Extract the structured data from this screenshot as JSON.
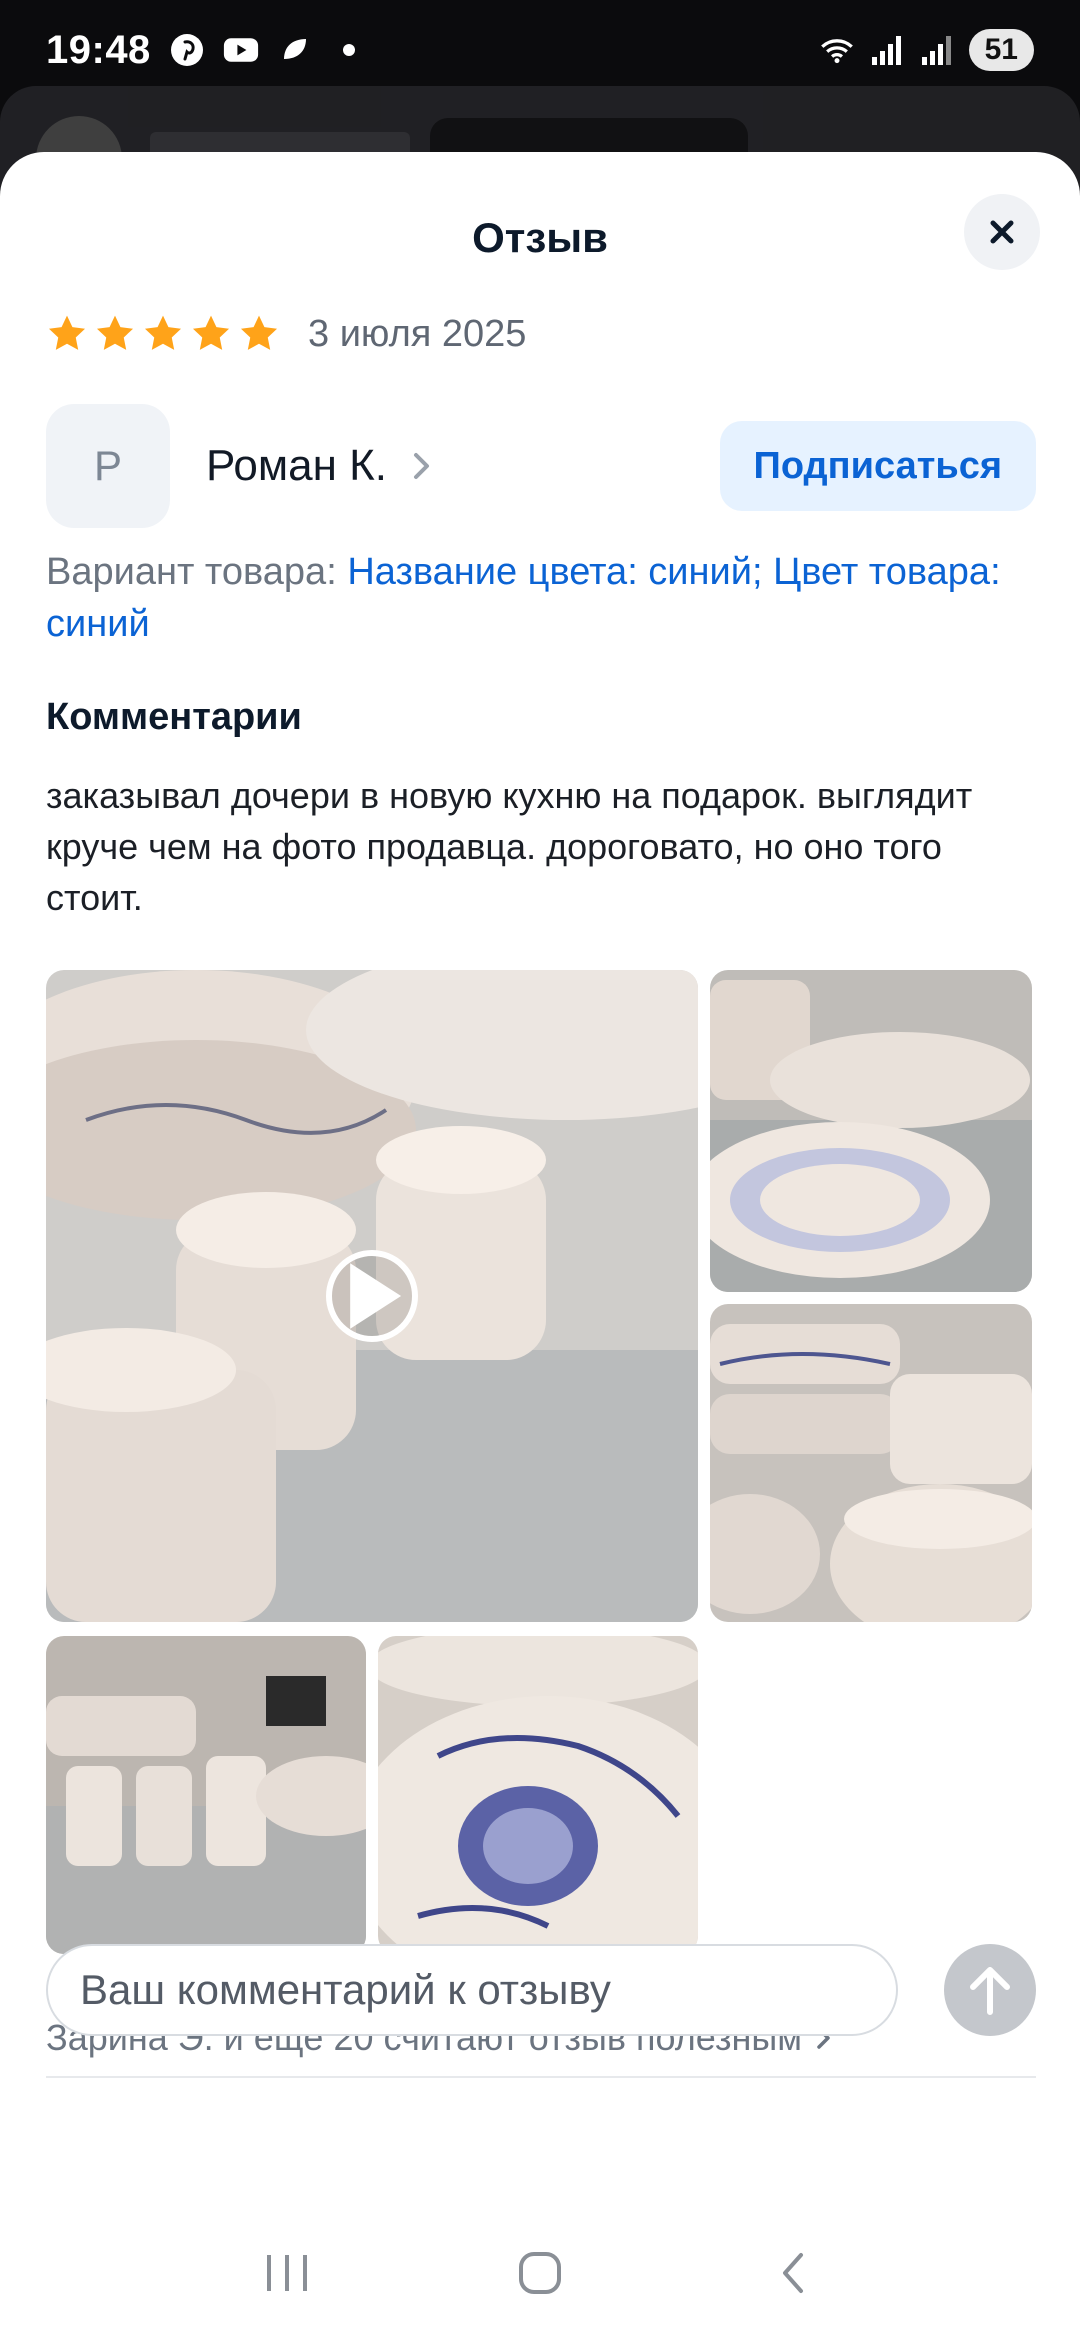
{
  "status_bar": {
    "time": "19:48",
    "battery": "51",
    "left_icons": [
      "pinterest-icon",
      "youtube-icon",
      "app-icon",
      "dot-icon"
    ],
    "right_icons": [
      "wifi-icon",
      "signal-icon",
      "signal-icon-2"
    ]
  },
  "sheet": {
    "title": "Отзыв",
    "close_icon": "close-icon"
  },
  "review": {
    "rating": 5,
    "max_rating": 5,
    "date": "3 июля 2025",
    "star_color": "#ffa319"
  },
  "author": {
    "initial": "Р",
    "name": "Роман К.",
    "subscribe_label": "Подписаться"
  },
  "variant": {
    "label": "Вариант товара: ",
    "value": "Название цвета: синий; Цвет товара: синий"
  },
  "comments": {
    "heading": "Комментарии",
    "text": "заказывал дочери в новую кухню на подарок. выглядит круче чем на фото продавца. дороговато, но оно того стоит."
  },
  "media": {
    "items": [
      {
        "type": "video",
        "icon": "play-icon"
      },
      {
        "type": "photo"
      },
      {
        "type": "photo"
      },
      {
        "type": "photo"
      },
      {
        "type": "photo"
      }
    ]
  },
  "helpful": {
    "text": "Зарина Э. и ещё 20 считают отзыв полезным"
  },
  "input": {
    "placeholder": "Ваш комментарий к отзыву",
    "value": ""
  },
  "colors": {
    "accent": "#0b63d4",
    "subscribe_bg": "#e6f2ff",
    "muted": "#6b7480"
  }
}
